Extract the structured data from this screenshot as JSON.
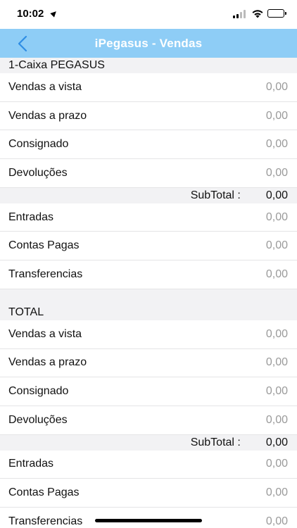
{
  "status": {
    "time": "10:02"
  },
  "nav": {
    "title": "iPegasus - Vendas"
  },
  "sections": [
    {
      "header": "1-Caixa PEGASUS",
      "rows1": [
        {
          "label": "Vendas a vista",
          "value": "0,00"
        },
        {
          "label": "Vendas a prazo",
          "value": "0,00"
        },
        {
          "label": "Consignado",
          "value": "0,00"
        },
        {
          "label": "Devoluções",
          "value": "0,00"
        }
      ],
      "subtotal": {
        "label": "SubTotal :",
        "value": "0,00"
      },
      "rows2": [
        {
          "label": "Entradas",
          "value": "0,00"
        },
        {
          "label": "Contas Pagas",
          "value": "0,00"
        },
        {
          "label": "Transferencias",
          "value": "0,00"
        }
      ]
    },
    {
      "header": "TOTAL",
      "rows1": [
        {
          "label": "Vendas a vista",
          "value": "0,00"
        },
        {
          "label": "Vendas a prazo",
          "value": "0,00"
        },
        {
          "label": "Consignado",
          "value": "0,00"
        },
        {
          "label": "Devoluções",
          "value": "0,00"
        }
      ],
      "subtotal": {
        "label": "SubTotal :",
        "value": "0,00"
      },
      "rows2": [
        {
          "label": "Entradas",
          "value": "0,00"
        },
        {
          "label": "Contas Pagas",
          "value": "0,00"
        },
        {
          "label": "Transferencias",
          "value": "0,00"
        }
      ]
    }
  ],
  "colors": {
    "navbar": "#8ecdf6",
    "accent": "#2f8de4",
    "value_text": "#9a9a9a",
    "section_bg": "#f2f2f4"
  }
}
